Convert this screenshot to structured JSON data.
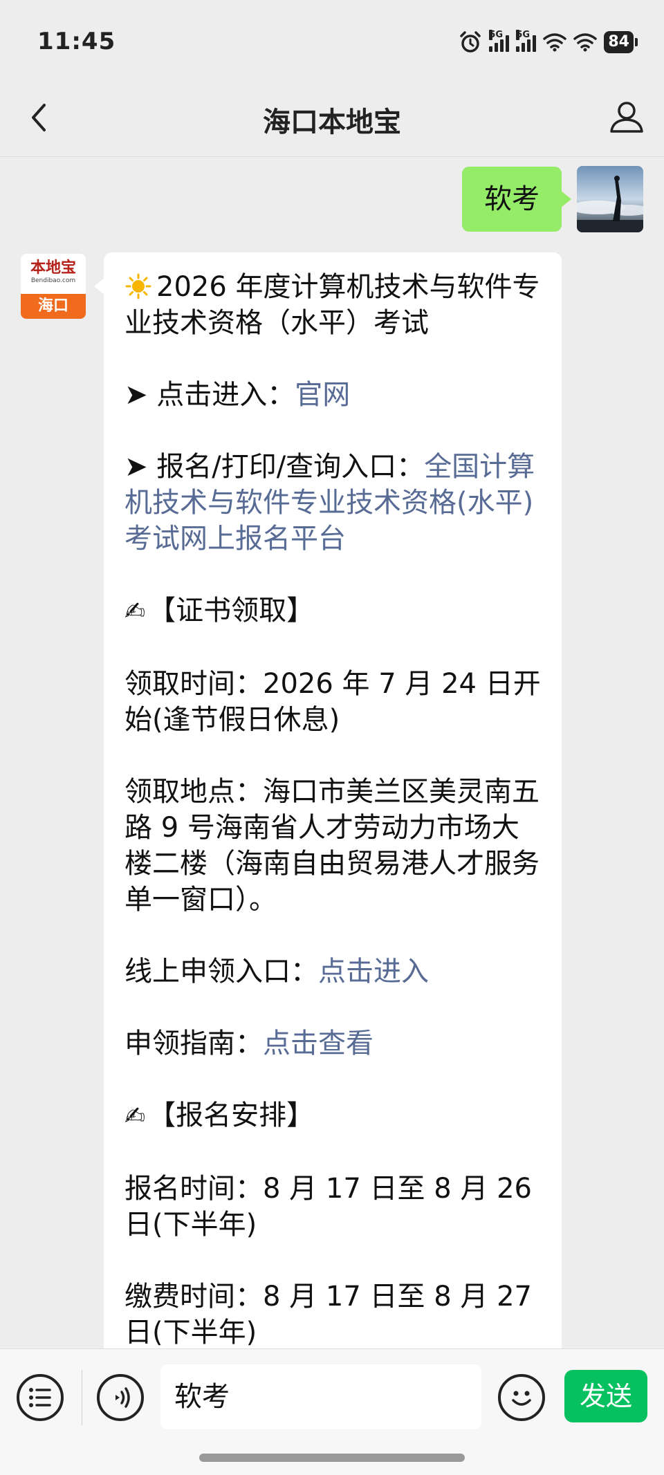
{
  "status_bar": {
    "time": "11:45",
    "battery": "84",
    "network_1": "5G",
    "network_2": "5G"
  },
  "nav": {
    "title": "海口本地宝"
  },
  "messages": {
    "user_message": "软考",
    "bot_avatar": {
      "top_text": "本地宝",
      "sub_text": "Bendibao.com",
      "city": "海口"
    },
    "bot_reply": {
      "title": "2026 年度计算机技术与软件专业技术资格（水平）考试",
      "official_prefix": "➤ 点击进入：",
      "official_link": "官网",
      "register_prefix": "➤ 报名/打印/查询入口：",
      "register_link": "全国计算机技术与软件专业技术资格(水平)考试网上报名平台",
      "cert_heading": "【证书领取】",
      "cert_time": "领取时间：2026 年 7 月 24 日开始(逢节假日休息)",
      "cert_place": "领取地点：海口市美兰区美灵南五路 9 号海南省人才劳动力市场大楼二楼（海南自由贸易港人才服务单一窗口）。",
      "online_prefix": "线上申领入口：",
      "online_link": "点击进入",
      "guide_prefix": "申领指南：",
      "guide_link": "点击查看",
      "signup_heading": "【报名安排】",
      "signup_time": "报名时间：8 月 17 日至 8 月 26 日(下半年)",
      "pay_time": "缴费时间：8 月 17 日至 8 月 27 日(下半年)"
    }
  },
  "input_bar": {
    "value": "软考",
    "send_label": "发送"
  },
  "colors": {
    "user_bubble": "#95ec69",
    "link": "#576b95",
    "send_button": "#07c160",
    "brand_orange": "#f06b1e"
  }
}
